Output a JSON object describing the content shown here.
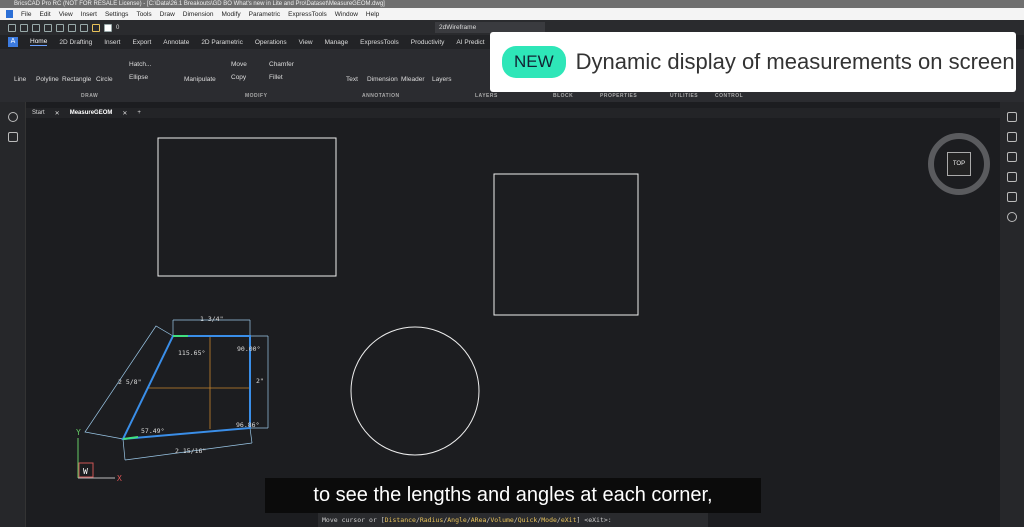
{
  "title": "BricsCAD Pro RC (NOT FOR RESALE License) - [C:\\Data\\26.1 Breakouts\\GD BO What's new in Lite and Pro\\Dataset\\MeasureGEOM.dwg]",
  "menu": [
    "File",
    "Edit",
    "View",
    "Insert",
    "Settings",
    "Tools",
    "Draw",
    "Dimension",
    "Modify",
    "Parametric",
    "ExpressTools",
    "Window",
    "Help"
  ],
  "toolbar": {
    "layer": "0",
    "visual_style": "2dWireframe"
  },
  "ribbon_tabs": [
    "Home",
    "2D Drafting",
    "Insert",
    "Export",
    "Annotate",
    "2D Parametric",
    "Operations",
    "View",
    "Manage",
    "ExpressTools",
    "Productivity",
    "AI Predict"
  ],
  "ribbon": {
    "line": "Line",
    "polyline": "Polyline",
    "rectangle": "Rectangle",
    "circle": "Circle",
    "hatch": "Hatch...",
    "ellipse": "Ellipse",
    "manipulate": "Manipulate",
    "move": "Move",
    "copy": "Copy",
    "chamfer": "Chamfer",
    "fillet": "Fillet",
    "text": "Text",
    "dimension": "Dimension",
    "mleader": "Mleader",
    "layers": "Layers"
  },
  "groups": [
    "DRAW",
    "MODIFY",
    "ANNOTATION",
    "LAYERS",
    "BLOCK",
    "PROPERTIES",
    "UTILITIES",
    "CONTROL"
  ],
  "doc_tabs": [
    "Start",
    "MeasureGEOM"
  ],
  "callout": {
    "badge": "NEW",
    "text": "Dynamic display of measurements on screen"
  },
  "navcube": "TOP",
  "dims": {
    "top": "1 3/4\"",
    "left": "2 5/8\"",
    "right": "2\"",
    "bottom": "2 15/16\"",
    "a1": "115.65°",
    "a2": "90.00°",
    "a3": "57.49°",
    "a4": "96.86°"
  },
  "ucs": {
    "x": "X",
    "y": "Y",
    "w": "W"
  },
  "subtitle": "to see the lengths and angles at each corner,",
  "command": {
    "prefix": "Move cursor or [",
    "opts": [
      "Distance",
      "Radius",
      "Angle",
      "ARea",
      "Volume",
      "Quick",
      "Mode",
      "eXit"
    ],
    "suffix": "] <eXit>:"
  }
}
